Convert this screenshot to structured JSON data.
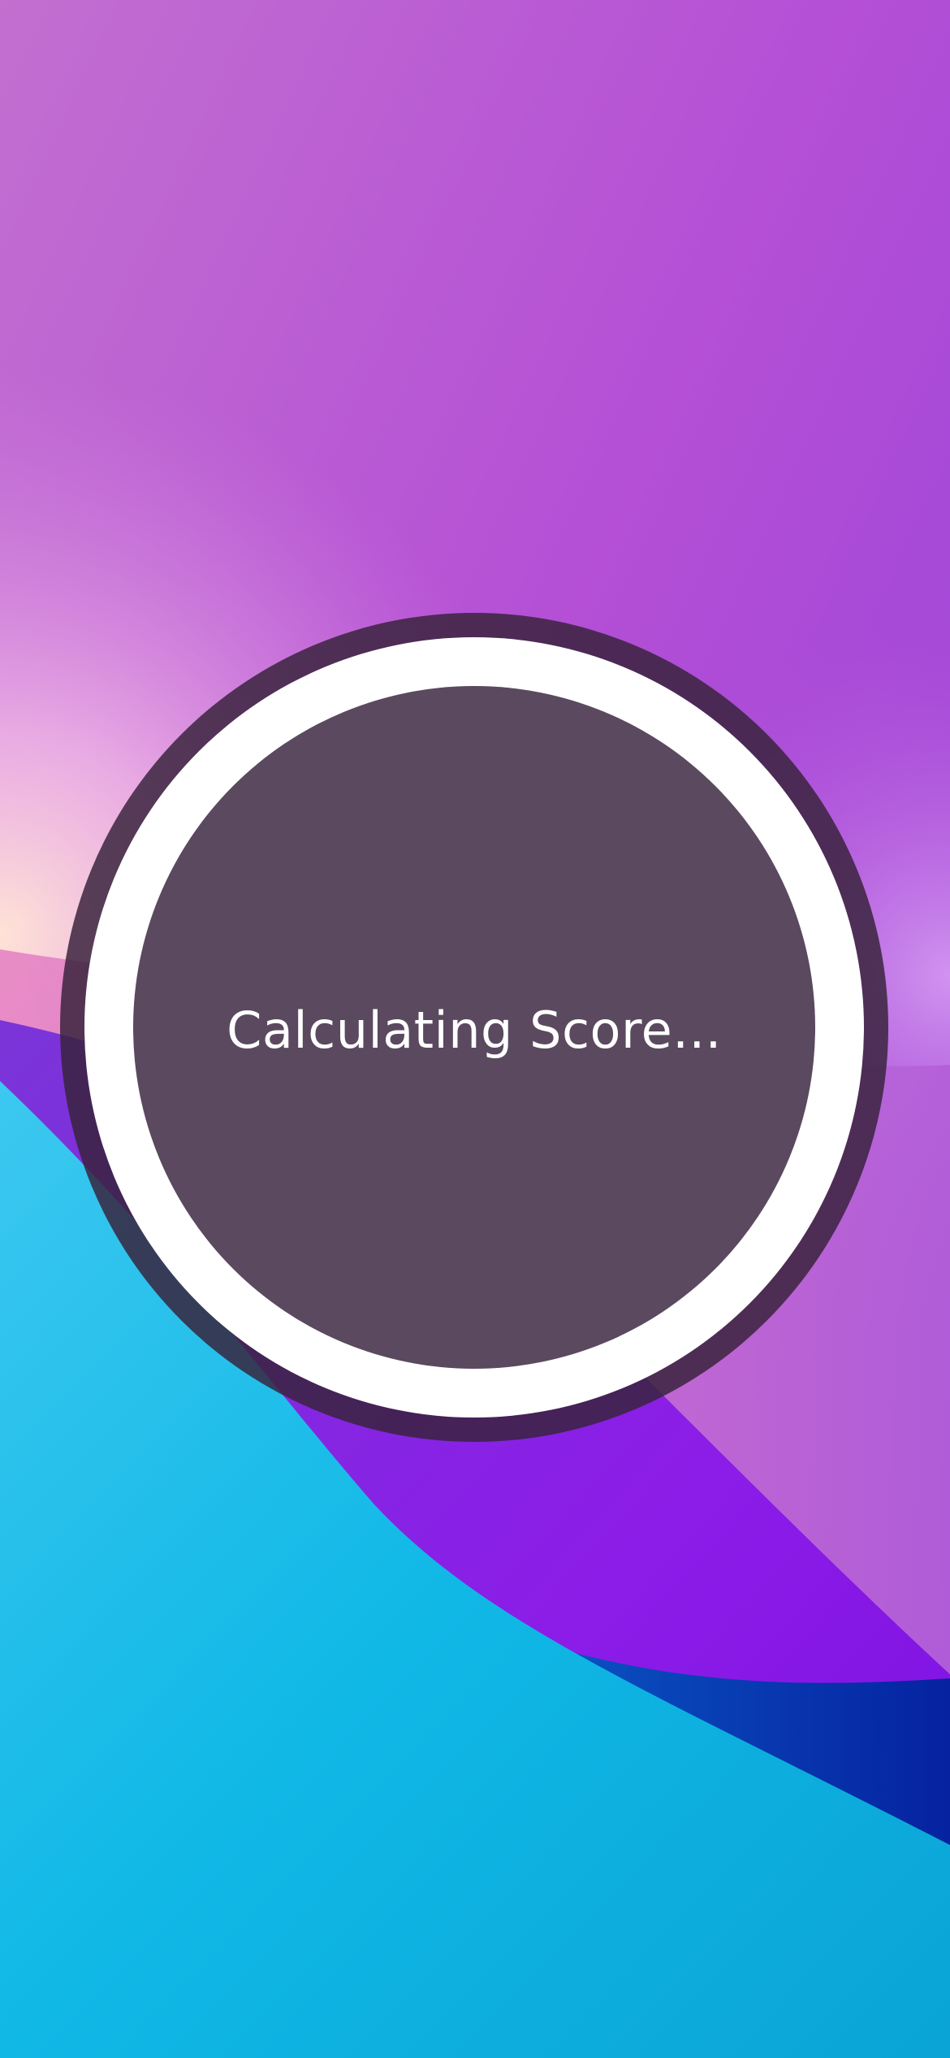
{
  "score_dial": {
    "status_text": "Calculating Score..."
  },
  "colors": {
    "ring_dark": "#3a2640",
    "ring_white": "#ffffff",
    "text": "#ffffff",
    "wallpaper_purple": "#b04fd8",
    "wallpaper_cyan": "#16c2ee",
    "wallpaper_violet": "#8a1ee8",
    "wallpaper_navy": "#0a2aa8",
    "wallpaper_peach": "#fbd8d8"
  }
}
